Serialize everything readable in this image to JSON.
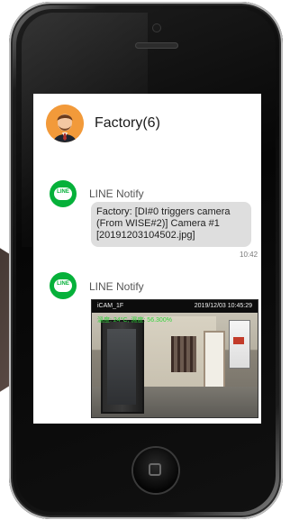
{
  "chat": {
    "title": "Factory(6)"
  },
  "messages": [
    {
      "sender": "LINE Notify",
      "lines": [
        "Factory: [DI#0 triggers camera",
        "(From WISE#2)] Camera #1",
        "[20191203104502.jpg]"
      ],
      "time": "10:42"
    },
    {
      "sender": "LINE Notify",
      "image": {
        "camera_name": "iCAM_1F",
        "timestamp": "2019/12/03 10:45:29",
        "overlay": "溫度: 24°C, 濕度: 56.300%"
      }
    }
  ],
  "icons": {
    "avatar": "businessman-avatar",
    "line_badge": "line-icon",
    "line_badge_text": "LINE"
  },
  "colors": {
    "line_green": "#06b13a",
    "avatar_orange": "#f29a3a"
  }
}
